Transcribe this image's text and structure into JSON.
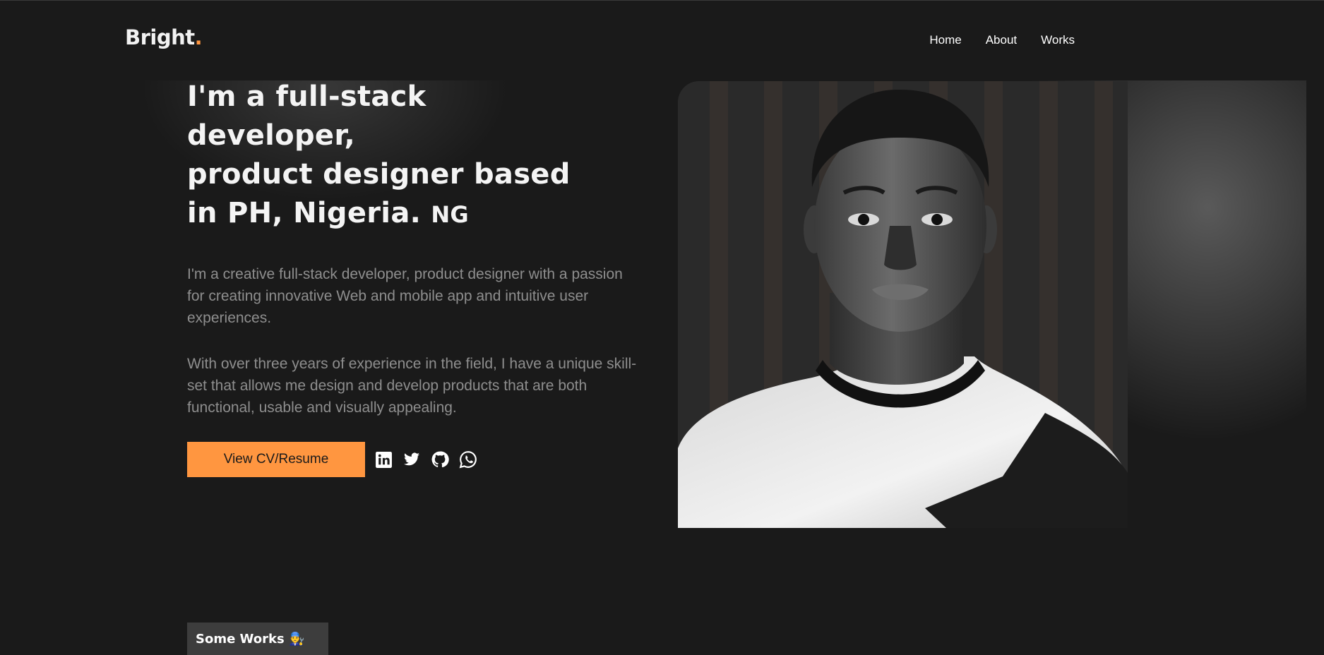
{
  "header": {
    "logo_text": "Bright",
    "logo_dot": ".",
    "nav": [
      {
        "label": "Home"
      },
      {
        "label": "About"
      },
      {
        "label": "Works"
      }
    ]
  },
  "hero": {
    "headline_lines": [
      "I'm a full-stack",
      "developer,",
      "product designer based",
      "in PH, Nigeria."
    ],
    "flag_text": "NG",
    "paragraph_1": "I'm a creative full-stack developer, product designer with a passion for creating innovative Web and mobile app and intuitive user experiences.",
    "paragraph_2": "With over three years of experience in the field, I have a unique skill-set that allows me design and develop products that are both functional, usable and visually appealing.",
    "cv_button_label": "View CV/Resume",
    "socials": [
      {
        "icon": "linkedin-icon"
      },
      {
        "icon": "twitter-icon"
      },
      {
        "icon": "github-icon"
      },
      {
        "icon": "whatsapp-icon"
      }
    ]
  },
  "works": {
    "label": "Some Works 👨‍🔧"
  },
  "colors": {
    "background": "#1a1a1a",
    "accent": "#ff9640",
    "muted_text": "#8e8e8e"
  }
}
